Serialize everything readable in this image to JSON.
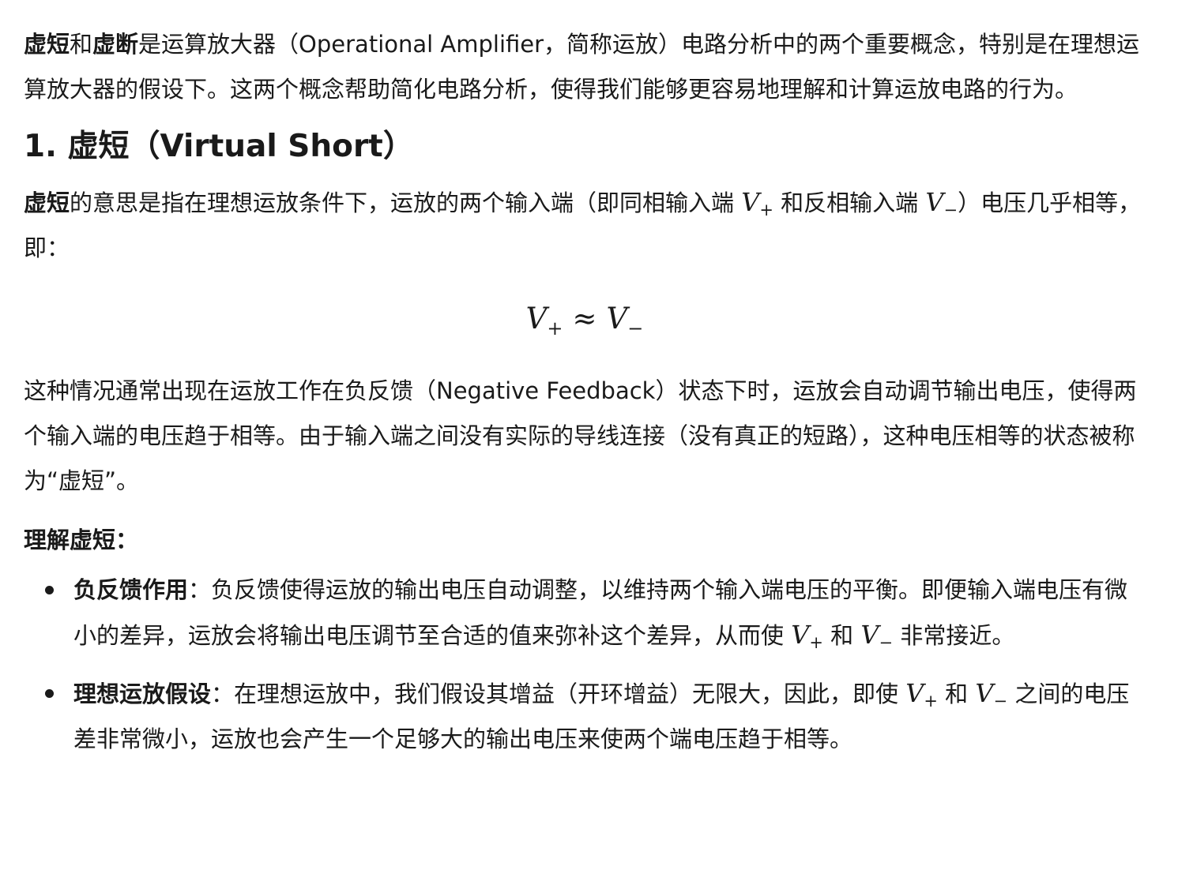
{
  "intro": {
    "term1": "虚短",
    "and": "和",
    "term2": "虚断",
    "text": "是运算放大器（Operational Amplifier，简称运放）电路分析中的两个重要概念，特别是在理想运算放大器的假设下。这两个概念帮助简化电路分析，使得我们能够更容易地理解和计算运放电路的行为。"
  },
  "section1": {
    "heading": "1. 虚短（Virtual Short）",
    "para1": {
      "term": "虚短",
      "text_a": "的意思是指在理想运放条件下，运放的两个输入端（即同相输入端 ",
      "text_b": " 和反相输入端 ",
      "text_c": "）电压几乎相等，即："
    },
    "formula": {
      "lhs_var": "V",
      "lhs_sub": "+",
      "op": "≈",
      "rhs_var": "V",
      "rhs_sub": "−"
    },
    "para2": "这种情况通常出现在运放工作在负反馈（Negative Feedback）状态下时，运放会自动调节输出电压，使得两个输入端的电压趋于相等。由于输入端之间没有实际的导线连接（没有真正的短路），这种电压相等的状态被称为“虚短”。",
    "subhead": "理解虚短：",
    "bullets": [
      {
        "term": "负反馈作用",
        "text_a": "：负反馈使得运放的输出电压自动调整，以维持两个输入端电压的平衡。即便输入端电压有微小的差异，运放会将输出电压调节至合适的值来弥补这个差异，从而使 ",
        "text_b": " 和 ",
        "text_c": " 非常接近。"
      },
      {
        "term": "理想运放假设",
        "text_a": "：在理想运放中，我们假设其增益（开环增益）无限大，因此，即使 ",
        "text_b": " 和 ",
        "text_c": " 之间的电压差非常微小，运放也会产生一个足够大的输出电压来使两个端电压趋于相等。"
      }
    ]
  },
  "symbols": {
    "v": "V",
    "plus": "+",
    "minus": "−"
  }
}
